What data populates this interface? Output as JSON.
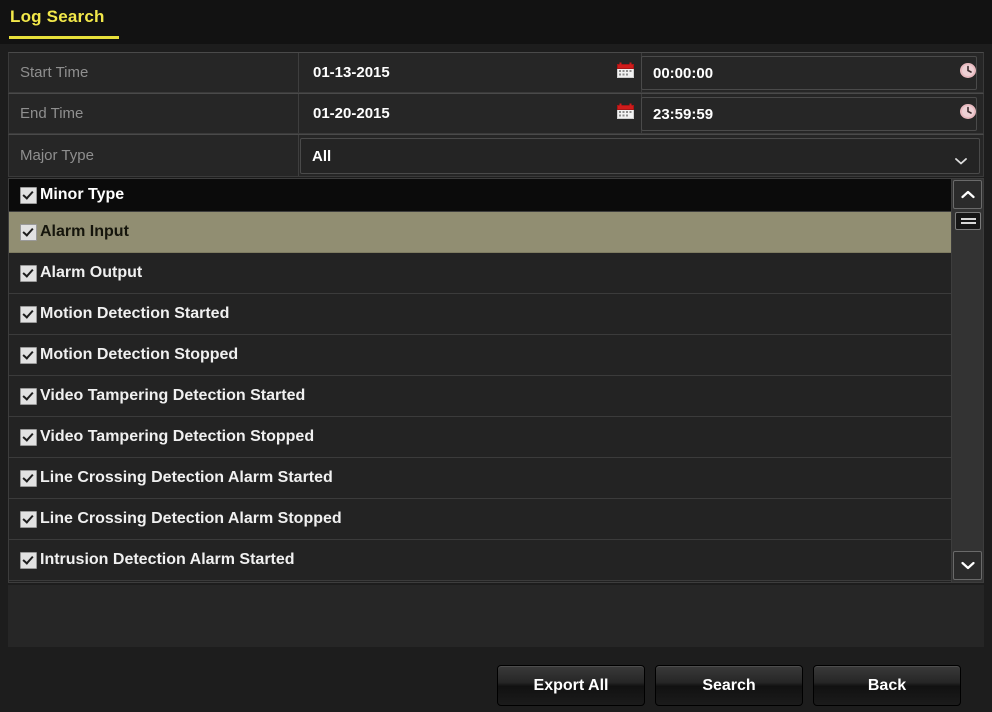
{
  "window": {
    "tab_title": "Log Search",
    "accent_color": "#e8e03a"
  },
  "form": {
    "rows": [
      {
        "label": "Start Time",
        "date_value": "01-13-2015",
        "time_value": "00:00:00",
        "calendar_icon": "calendar-icon",
        "clock_icon": "clock-icon"
      },
      {
        "label": "End Time",
        "date_value": "01-20-2015",
        "time_value": "23:59:59",
        "calendar_icon": "calendar-icon",
        "clock_icon": "clock-icon"
      }
    ],
    "major_type": {
      "label": "Major Type",
      "value": "All",
      "chevron_icon": "chevron-down-icon"
    }
  },
  "minor_type_list": {
    "header": "Minor Type",
    "header_checked": true,
    "items": [
      {
        "label": "Alarm Input",
        "checked": true,
        "selected": true
      },
      {
        "label": "Alarm Output",
        "checked": true,
        "selected": false
      },
      {
        "label": "Motion Detection Started",
        "checked": true,
        "selected": false
      },
      {
        "label": "Motion Detection Stopped",
        "checked": true,
        "selected": false
      },
      {
        "label": "Video Tampering Detection Started",
        "checked": true,
        "selected": false
      },
      {
        "label": "Video Tampering Detection Stopped",
        "checked": true,
        "selected": false
      },
      {
        "label": "Line Crossing Detection Alarm Started",
        "checked": true,
        "selected": false
      },
      {
        "label": "Line Crossing Detection Alarm Stopped",
        "checked": true,
        "selected": false
      },
      {
        "label": "Intrusion Detection Alarm Started",
        "checked": true,
        "selected": false
      }
    ],
    "scrollbar": {
      "up_icon": "chevron-up-icon",
      "down_icon": "chevron-down-icon",
      "thumb_icon": "scroll-thumb-grip"
    }
  },
  "footer": {
    "buttons": [
      {
        "label": "Export All"
      },
      {
        "label": "Search"
      },
      {
        "label": "Back"
      }
    ]
  }
}
